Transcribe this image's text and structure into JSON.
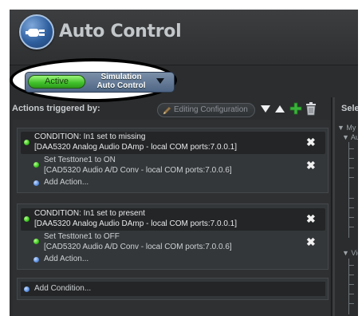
{
  "header": {
    "app_title": "Auto Control",
    "logo_icon": "plug-icon"
  },
  "mode": {
    "active_label": "Active",
    "mode_line1": "Simulation",
    "mode_line2": "Auto Control"
  },
  "toolbar": {
    "actions_label": "Actions triggered by:",
    "edit_config_label": "Editing Configuration",
    "right_panel_title": "Select"
  },
  "conditions": [
    {
      "condition": "CONDITION: In1 set to missing",
      "device": "[DAA5320 Analog Audio DAmp - local COM ports:7.0.0.1]",
      "action": "Set Testtone1 to ON",
      "action_device": "[CAD5320 Audio A/D Conv - local COM ports:7.0.0.6]",
      "add_action": "Add Action..."
    },
    {
      "condition": "CONDITION: In1 set to present",
      "device": "[DAA5320 Analog Audio DAmp - local COM ports:7.0.0.1]",
      "action": "Set Testtone1 to OFF",
      "action_device": "[CAD5320 Audio A/D Conv - local COM ports:7.0.0.6]",
      "add_action": "Add Action..."
    }
  ],
  "add_condition": "Add Condition...",
  "tree": {
    "root": "My C",
    "child1": "Au",
    "child2": "Vid"
  },
  "colors": {
    "active_green": "#3fbf2a",
    "panel": "#2b2d2e",
    "add_plus": "#3ab33a"
  }
}
